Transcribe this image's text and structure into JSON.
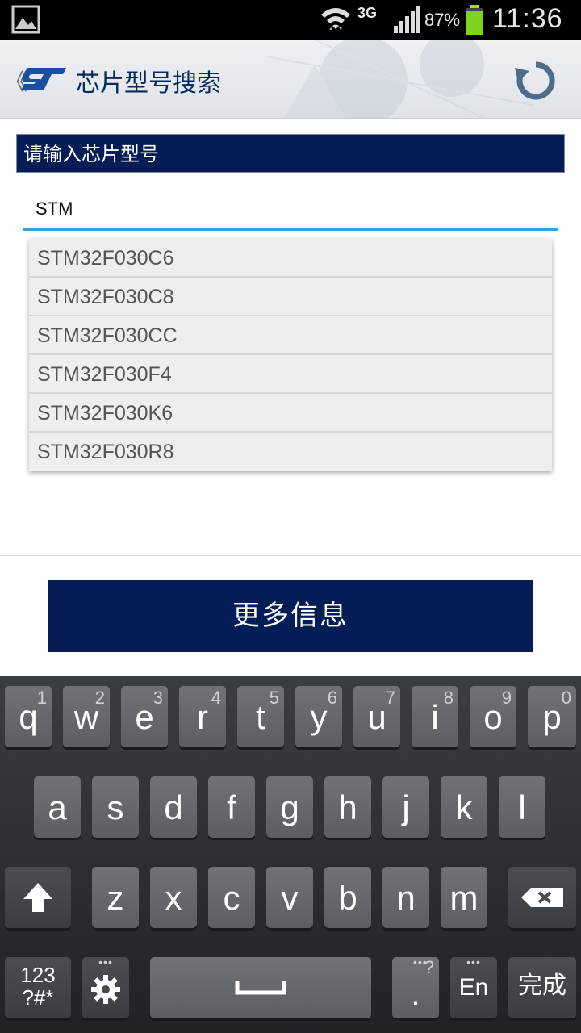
{
  "status_bar": {
    "network": "3G",
    "battery_percent": "87%",
    "time": "11:36"
  },
  "action_bar": {
    "back_glyph": "《",
    "logo_icon": "st-logo-icon",
    "title": "芯片型号搜索",
    "refresh_icon": "refresh-icon"
  },
  "form": {
    "header": "请输入芯片型号",
    "search_value": "STM"
  },
  "suggestions": [
    "STM32F030C6",
    "STM32F030C8",
    "STM32F030CC",
    "STM32F030F4",
    "STM32F030K6",
    "STM32F030R8"
  ],
  "more_button": "更多信息",
  "keyboard": {
    "row1": [
      {
        "label": "q",
        "hint": "1"
      },
      {
        "label": "w",
        "hint": "2"
      },
      {
        "label": "e",
        "hint": "3"
      },
      {
        "label": "r",
        "hint": "4"
      },
      {
        "label": "t",
        "hint": "5"
      },
      {
        "label": "y",
        "hint": "6"
      },
      {
        "label": "u",
        "hint": "7"
      },
      {
        "label": "i",
        "hint": "8"
      },
      {
        "label": "o",
        "hint": "9"
      },
      {
        "label": "p",
        "hint": "0"
      }
    ],
    "row2": [
      "a",
      "s",
      "d",
      "f",
      "g",
      "h",
      "j",
      "k",
      "l"
    ],
    "row3": [
      "z",
      "x",
      "c",
      "v",
      "b",
      "n",
      "m"
    ],
    "symbols_line1": "123",
    "symbols_line2": "?#*",
    "period": ".",
    "period_hint": "?",
    "language": "En",
    "done": "完成",
    "more_dots": "•••"
  }
}
